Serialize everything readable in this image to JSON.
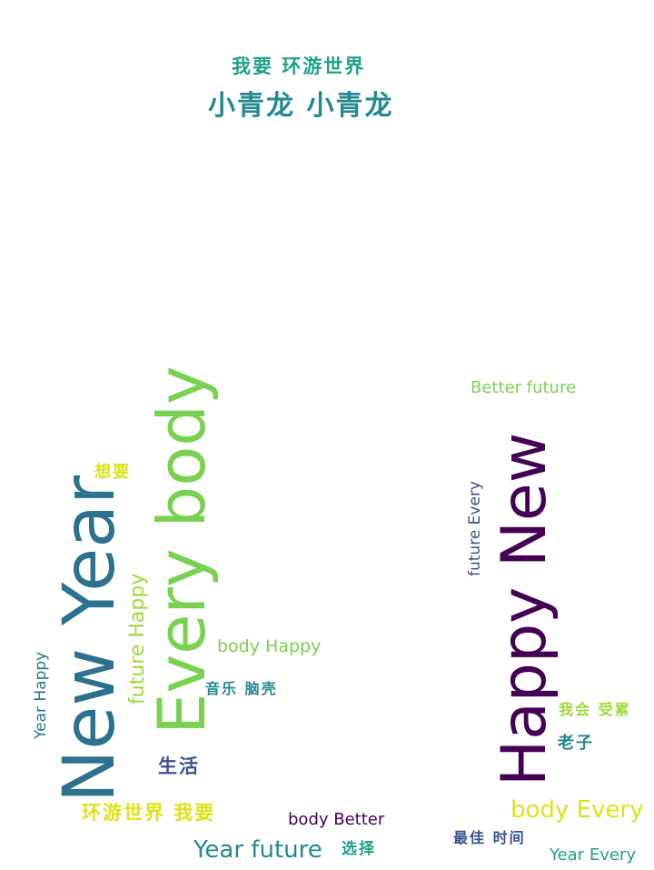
{
  "colors": {
    "teal": "#23898e",
    "green": "#7ad151",
    "purple": "#440154",
    "yellow": "#dde318",
    "blue": "#2c728e",
    "navy": "#3b528b",
    "mid_green": "#29af7f"
  },
  "words": [
    {
      "text": "我要 环游世界"
    },
    {
      "text": "小青龙 小青龙"
    },
    {
      "text": "Better future"
    },
    {
      "text": "想要"
    },
    {
      "text": "Every body"
    },
    {
      "text": "New Year"
    },
    {
      "text": "future Happy"
    },
    {
      "text": "body Happy"
    },
    {
      "text": "Year Happy"
    },
    {
      "text": "音乐 脑壳"
    },
    {
      "text": "生活"
    },
    {
      "text": "环游世界 我要"
    },
    {
      "text": "body Better"
    },
    {
      "text": "Year future"
    },
    {
      "text": "选择"
    },
    {
      "text": "future Every"
    },
    {
      "text": "Happy New"
    },
    {
      "text": "我会 受累"
    },
    {
      "text": "老子"
    },
    {
      "text": "body Every"
    },
    {
      "text": "最佳 时间"
    },
    {
      "text": "Year Every"
    }
  ]
}
